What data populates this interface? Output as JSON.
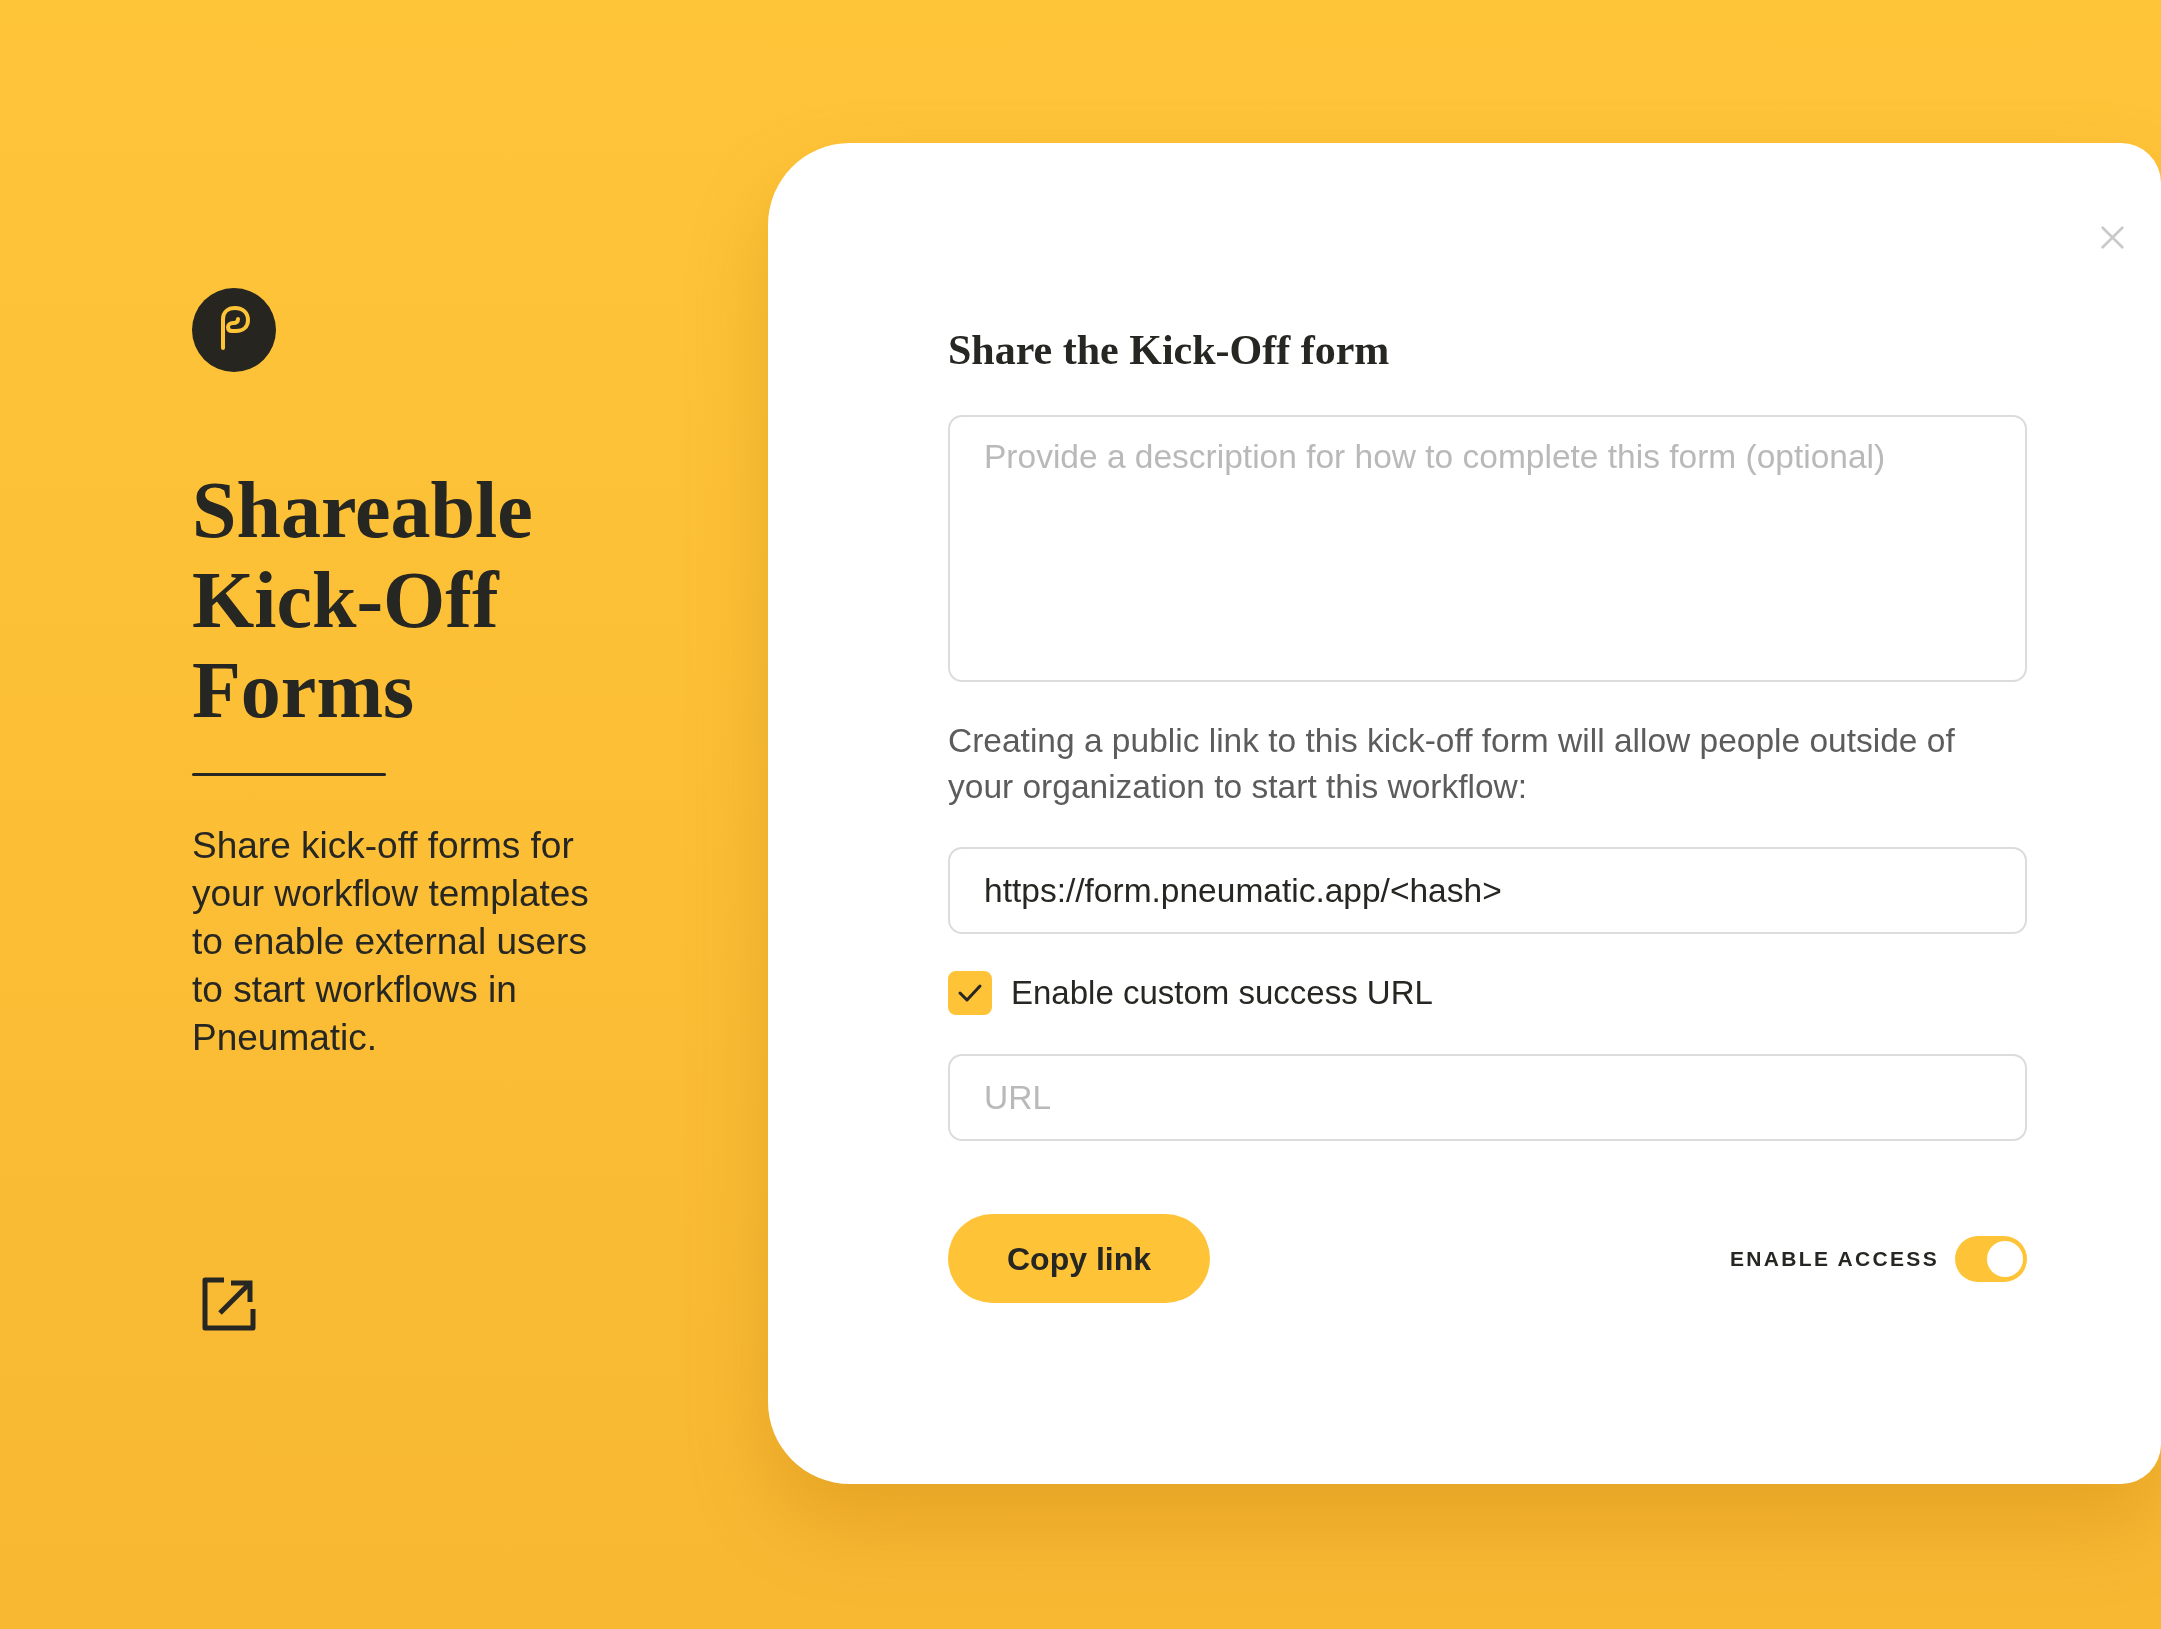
{
  "intro": {
    "title": "Shareable Kick-Off Forms",
    "description": "Share kick-off forms for your workflow templates to enable external users to start workflows in Pneumatic."
  },
  "modal": {
    "title": "Share the Kick-Off form",
    "description_field": {
      "placeholder": "Provide a description for how to complete this form (optional)"
    },
    "notice": "Creating a public link to this kick-off form will allow people outside of your organization to start this workflow:",
    "link_field": {
      "value": "https://form.pneumatic.app/<hash>"
    },
    "success_url_option": {
      "label": "Enable custom success URL",
      "checked": true
    },
    "success_url_field": {
      "placeholder": "URL"
    },
    "copy_button": {
      "label": "Copy link"
    },
    "access_toggle": {
      "label": "ENABLE ACCESS",
      "on": true
    }
  }
}
